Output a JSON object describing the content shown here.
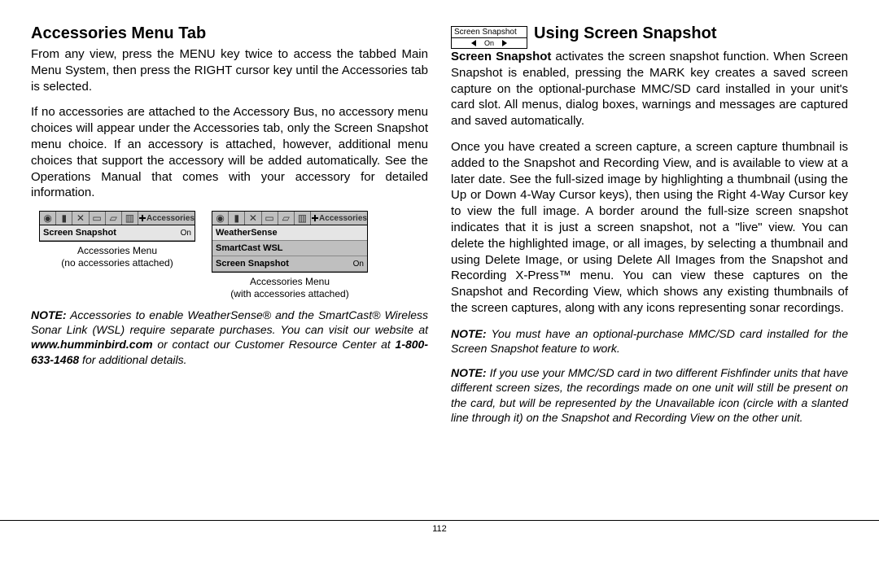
{
  "left": {
    "heading": "Accessories Menu Tab",
    "p1": "From any view, press the MENU key twice to access the tabbed Main Menu System, then press the RIGHT cursor key until the Accessories tab is selected.",
    "p2": "If no accessories are attached to the Accessory Bus, no accessory menu choices will appear under the Accessories tab, only the Screen Snapshot menu choice. If an accessory is attached, however, additional menu choices that support the accessory will be added automatically. See the Operations Manual that comes with your accessory for detailed information.",
    "fig1": {
      "tab_label": "Accessories",
      "row1": "Screen Snapshot",
      "row1_val": "On",
      "caption_l1": "Accessories Menu",
      "caption_l2": "(no accessories attached)"
    },
    "fig2": {
      "tab_label": "Accessories",
      "row1": "WeatherSense",
      "row2": "SmartCast WSL",
      "row3": "Screen Snapshot",
      "row3_val": "On",
      "caption_l1": "Accessories Menu",
      "caption_l2": "(with accessories attached)"
    },
    "note_label": "NOTE:",
    "note_body_a": " Accessories to enable WeatherSense® and the SmartCast® Wireless Sonar Link (WSL) require separate purchases. You can visit our website at ",
    "note_url": "www.humminbird.com",
    "note_body_b": " or contact our Customer Resource Center at ",
    "note_phone": "1-800-633-1468",
    "note_body_c": " for additional details."
  },
  "right": {
    "mini_title": "Screen Snapshot",
    "mini_value": "On",
    "heading": "Using Screen Snapshot",
    "p1_a": "Screen Snapshot",
    "p1_b": " activates the screen snapshot function. When Screen Snapshot is enabled, pressing the MARK key creates a saved screen capture on the optional-purchase MMC/SD card installed in your unit's card slot. All menus, dialog boxes, warnings and messages are captured and saved automatically.",
    "p2": "Once you have created a screen capture, a screen capture thumbnail is added to the Snapshot and Recording View, and is available to view at a later date. See the full-sized image by highlighting a thumbnail (using the Up or Down 4-Way Cursor keys), then using the Right 4-Way Cursor key to view the full image. A border around the full-size screen snapshot indicates that it is just a screen snapshot, not a \"live\" view. You can delete the highlighted image, or all images, by selecting a thumbnail and using Delete Image, or using Delete All Images from the Snapshot and Recording X-Press™ menu. You can view these captures on the Snapshot and Recording View, which shows any existing thumbnails of the screen captures, along with any icons representing sonar recordings.",
    "note1_label": "NOTE:",
    "note1_body": " You must have an optional-purchase MMC/SD card installed for the Screen Snapshot feature to work.",
    "note2_label": "NOTE:",
    "note2_body": " If you use your MMC/SD card in two different Fishfinder units that have different screen sizes, the recordings made on one unit will still be present on the card, but will be represented by the Unavailable icon (circle with a slanted line through it) on the Snapshot and Recording View on the other unit."
  },
  "page_number": "112"
}
